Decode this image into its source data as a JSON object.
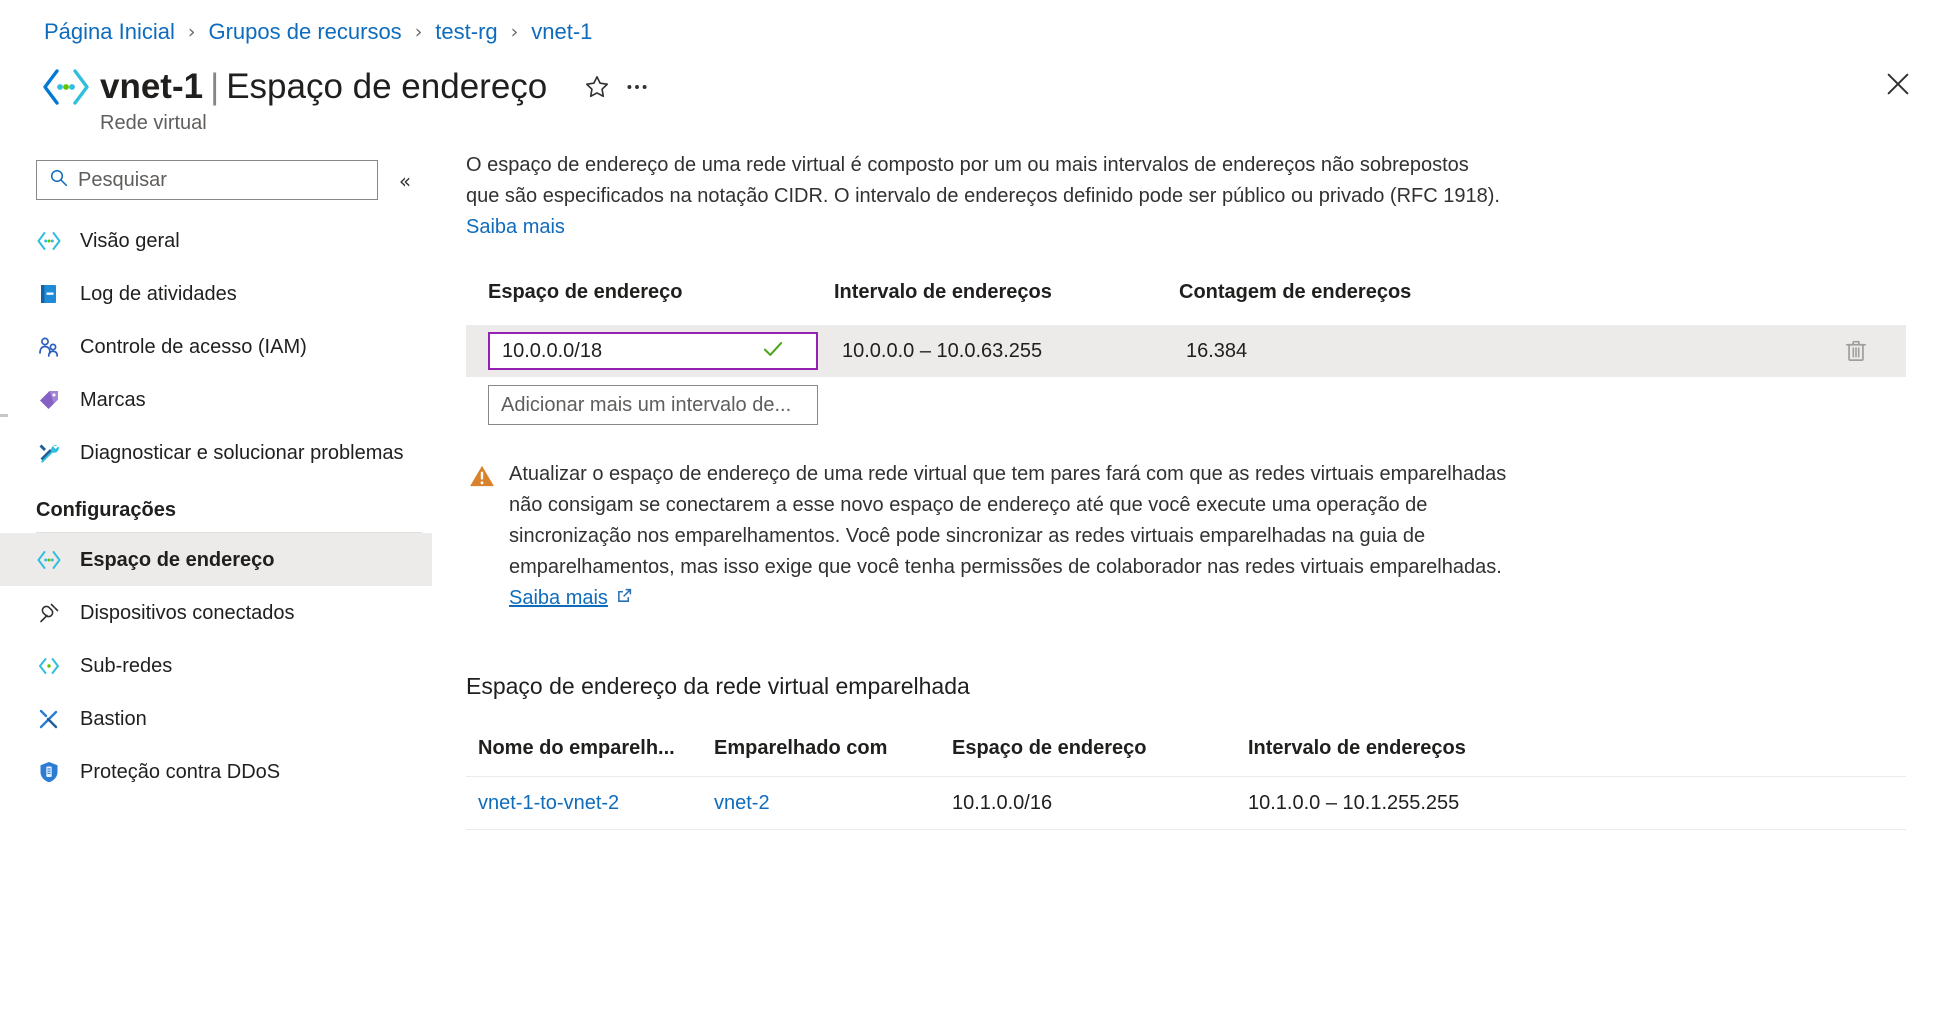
{
  "breadcrumb": {
    "items": [
      {
        "label": "Página Inicial"
      },
      {
        "label": "Grupos de recursos"
      },
      {
        "label": "test-rg"
      },
      {
        "label": "vnet-1"
      }
    ],
    "separator": "›"
  },
  "header": {
    "resource_name": "vnet-1",
    "separator": "|",
    "page_title": "Espaço de endereço",
    "subtitle": "Rede virtual",
    "favorite_icon": "star-icon",
    "more_icon": "ellipsis-icon",
    "close_icon": "close-icon"
  },
  "sidebar": {
    "search": {
      "placeholder": "Pesquisar",
      "value": "",
      "icon": "search-icon"
    },
    "collapse_icon": "chevron-double-left-icon",
    "items": [
      {
        "label": "Visão geral",
        "icon": "vnet-icon",
        "selected": false
      },
      {
        "label": "Log de atividades",
        "icon": "activity-log-icon",
        "selected": false
      },
      {
        "label": "Controle de acesso (IAM)",
        "icon": "access-control-icon",
        "selected": false
      },
      {
        "label": "Marcas",
        "icon": "tag-icon",
        "selected": false
      },
      {
        "label": "Diagnosticar e solucionar problemas",
        "icon": "troubleshoot-icon",
        "selected": false
      }
    ],
    "section_label": "Configurações",
    "settings_items": [
      {
        "label": "Espaço de endereço",
        "icon": "address-space-icon",
        "selected": true
      },
      {
        "label": "Dispositivos conectados",
        "icon": "connected-devices-icon",
        "selected": false
      },
      {
        "label": "Sub-redes",
        "icon": "subnet-icon",
        "selected": false
      },
      {
        "label": "Bastion",
        "icon": "bastion-icon",
        "selected": false
      },
      {
        "label": "Proteção contra DDoS",
        "icon": "ddos-shield-icon",
        "selected": false
      }
    ]
  },
  "main": {
    "description": "O espaço de endereço de uma rede virtual é composto por um ou mais intervalos de endereços não sobrepostos que são especificados na notação CIDR. O intervalo de endereços definido pode ser público ou privado (RFC 1918). ",
    "description_link": "Saiba mais",
    "address_table": {
      "columns": [
        "Espaço de endereço",
        "Intervalo de endereços",
        "Contagem de endereços"
      ],
      "rows": [
        {
          "address_space": "10.0.0.0/18",
          "address_range": "10.0.0.0 – 10.0.63.255",
          "address_count": "16.384",
          "valid": true,
          "valid_icon": "checkmark-icon",
          "delete_icon": "trash-icon"
        }
      ],
      "add_placeholder": "Adicionar mais um intervalo de..."
    },
    "warning": {
      "icon": "warning-triangle-icon",
      "text": "Atualizar o espaço de endereço de uma rede virtual que tem pares fará com que as redes virtuais emparelhadas não consigam se conectarem a esse novo espaço de endereço até que você execute uma operação de sincronização nos emparelhamentos. Você pode sincronizar as redes virtuais emparelhadas na guia de emparelhamentos, mas isso exige que você tenha permissões de colaborador nas redes virtuais emparelhadas. ",
      "link": "Saiba mais",
      "link_icon": "external-link-icon"
    },
    "peered": {
      "title": "Espaço de endereço da rede virtual emparelhada",
      "columns": [
        "Nome do emparelh...",
        "Emparelhado com",
        "Espaço de endereço",
        "Intervalo de endereços"
      ],
      "rows": [
        {
          "peering_name": "vnet-1-to-vnet-2",
          "peered_with": "vnet-2",
          "address_space": "10.1.0.0/16",
          "address_range": "10.1.0.0 – 10.1.255.255"
        }
      ]
    }
  },
  "colors": {
    "link": "#0f6cbd",
    "focus_border": "#9521b3",
    "valid_check": "#4ca619",
    "warning": "#d9822b",
    "selected_row_bg": "#edebe9",
    "accent": "#0078d4"
  }
}
